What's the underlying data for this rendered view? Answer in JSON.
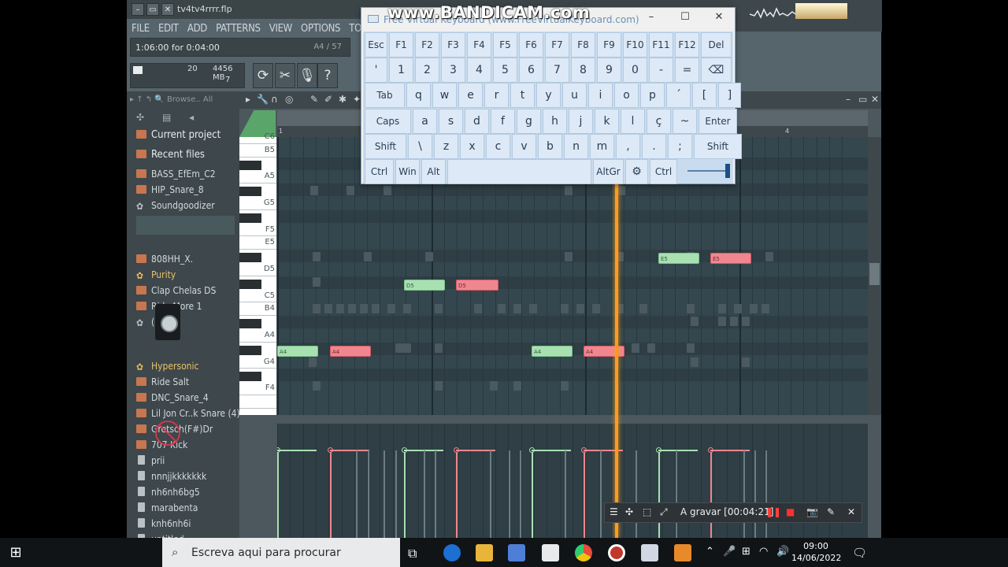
{
  "app": {
    "file_name": "tv4tv4rrrr.flp",
    "menu": [
      "FILE",
      "EDIT",
      "ADD",
      "PATTERNS",
      "VIEW",
      "OPTIONS",
      "TOOLS",
      "?"
    ],
    "hint_left": "1:06:00 for 0:04:00",
    "hint_right": "A4 / 57",
    "mem_value": "20",
    "mem_mb": "4456 MB",
    "mem_poly": "7"
  },
  "browser": {
    "toolbar": "Browse.. All",
    "sections": [
      "Current project",
      "Recent files"
    ],
    "items": [
      {
        "label": "BASS_EfEm_C2",
        "icon": "folder"
      },
      {
        "label": "HIP_Snare_8",
        "icon": "folder"
      },
      {
        "label": "Soundgoodizer",
        "icon": "gear"
      },
      {
        "label": "808HH_X.",
        "icon": "folder"
      },
      {
        "label": "Purity",
        "icon": "gear-yellow"
      },
      {
        "label": "Clap Chelas DS",
        "icon": "folder"
      },
      {
        "label": "Ride More 1",
        "icon": "folder"
      },
      {
        "label": "(none)",
        "icon": "gear"
      },
      {
        "label": "Hypersonic",
        "icon": "gear-yellow"
      },
      {
        "label": "Ride Salt",
        "icon": "folder"
      },
      {
        "label": "DNC_Snare_4",
        "icon": "folder"
      },
      {
        "label": "Lil Jon Cr..k Snare (4)",
        "icon": "folder"
      },
      {
        "label": "Gretsch(F#)Dr",
        "icon": "folder"
      },
      {
        "label": "707 Kick",
        "icon": "folder"
      },
      {
        "label": "prii",
        "icon": "file"
      },
      {
        "label": "nnnjjkkkkkkk",
        "icon": "file"
      },
      {
        "label": "nh6nh6bg5",
        "icon": "file"
      },
      {
        "label": "marabenta",
        "icon": "file"
      },
      {
        "label": "knh6nh6i",
        "icon": "file"
      },
      {
        "label": "untitled",
        "icon": "file"
      }
    ]
  },
  "piano_roll": {
    "bar_numbers": [
      "1",
      "4"
    ],
    "key_labels": [
      "C6",
      "B5",
      "A5",
      "G5",
      "F5",
      "E5",
      "D5",
      "C5",
      "B4",
      "A4",
      "G4",
      "F4"
    ],
    "notes": [
      {
        "label": "A4",
        "color": "green"
      },
      {
        "label": "A4",
        "color": "red"
      },
      {
        "label": "D5",
        "color": "green"
      },
      {
        "label": "D5",
        "color": "red"
      },
      {
        "label": "A4",
        "color": "green"
      },
      {
        "label": "A4",
        "color": "red"
      },
      {
        "label": "E5",
        "color": "green"
      },
      {
        "label": "E5",
        "color": "red"
      }
    ]
  },
  "virtual_keyboard": {
    "title": "Free Virtual Keyboard (www.FreeVirtualKeyboard.com)",
    "rows": [
      [
        "Esc",
        "F1",
        "F2",
        "F3",
        "F4",
        "F5",
        "F6",
        "F7",
        "F8",
        "F9",
        "F10",
        "F11",
        "F12",
        "Del"
      ],
      [
        "'",
        "1",
        "2",
        "3",
        "4",
        "5",
        "6",
        "7",
        "8",
        "9",
        "0",
        "-",
        "=",
        "⌫"
      ],
      [
        "Tab",
        "q",
        "w",
        "e",
        "r",
        "t",
        "y",
        "u",
        "i",
        "o",
        "p",
        "´",
        "[",
        "]"
      ],
      [
        "Caps",
        "a",
        "s",
        "d",
        "f",
        "g",
        "h",
        "j",
        "k",
        "l",
        "ç",
        "~",
        "Enter"
      ],
      [
        "Shift",
        "\\",
        "z",
        "x",
        "c",
        "v",
        "b",
        "n",
        "m",
        ",",
        ".",
        ";",
        "Shift"
      ],
      [
        "Ctrl",
        "Win",
        "Alt",
        "",
        "AltGr",
        "⚙",
        "Ctrl"
      ]
    ]
  },
  "watermark": "www.BANDICAM.com",
  "recorder": {
    "status": "A gravar [00:04:21]"
  },
  "taskbar": {
    "search_placeholder": "Escreva aqui para procurar",
    "time": "09:00",
    "date": "14/06/2022"
  },
  "colors": {
    "note_green": "#a8e0b2",
    "note_red": "#f0868f",
    "playhead": "#ff9c1c",
    "grid_bg": "#34474e"
  }
}
